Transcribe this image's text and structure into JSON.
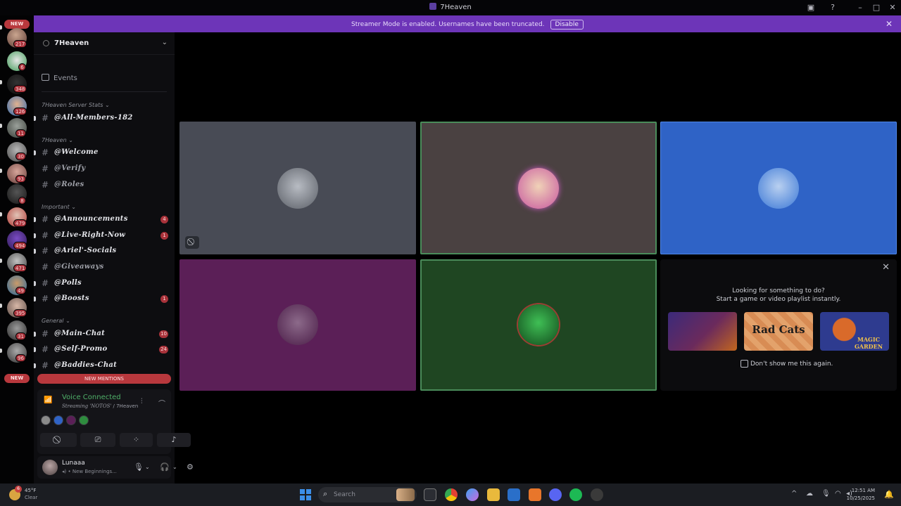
{
  "window": {
    "title": "7Heaven"
  },
  "banner": {
    "message": "Streamer Mode is enabled. Usernames have been truncated.",
    "disable_label": "Disable",
    "background": "#6d35b8"
  },
  "rail": {
    "new_top": "NEW",
    "new_bottom": "NEW",
    "badges": [
      "217",
      "6",
      "348",
      "126",
      "11",
      "30",
      "93",
      "8",
      "479",
      "494",
      "471",
      "49",
      "395",
      "31",
      "96"
    ]
  },
  "server": {
    "name": "7Heaven",
    "events_label": "Events",
    "categories": {
      "stats": "7Heaven Server Stats",
      "main": "7Heaven",
      "important": "Important",
      "general": "General"
    },
    "channels": [
      {
        "name": "𝕬𝖑𝖑-𝕸𝖊𝖒𝖇𝖊𝖗𝖘-182",
        "display": "@All-Members-182",
        "badge": ""
      },
      {
        "name": "welcome",
        "display": "@Welcome",
        "badge": ""
      },
      {
        "name": "verify",
        "display": "@Verify",
        "badge": ""
      },
      {
        "name": "roles",
        "display": "@Roles",
        "badge": ""
      },
      {
        "name": "announcements",
        "display": "@Announcements",
        "badge": "4"
      },
      {
        "name": "live-right-now",
        "display": "@Live-Right-Now",
        "badge": "1"
      },
      {
        "name": "ariel-socials",
        "display": "@Ariel'-Socials",
        "badge": ""
      },
      {
        "name": "giveaways",
        "display": "@Giveaways",
        "badge": ""
      },
      {
        "name": "polls",
        "display": "@Polls",
        "badge": ""
      },
      {
        "name": "boosts",
        "display": "@Boosts",
        "badge": "1"
      },
      {
        "name": "main-chat",
        "display": "@Main-Chat",
        "badge": "10"
      },
      {
        "name": "self-promo",
        "display": "@Self-Promo",
        "badge": "24"
      },
      {
        "name": "baddies-chat",
        "display": "@Baddies-Chat",
        "badge": ""
      }
    ],
    "new_mentions_label": "NEW MENTIONS"
  },
  "voice": {
    "status": "Voice Connected",
    "detail_prefix": "Streaming",
    "detail_channel": "'NOTOS'",
    "detail_suffix": " / 7Heaven"
  },
  "user": {
    "name": "Lunaaa",
    "status": "New Beginnings..."
  },
  "stage": {
    "tile_colors": [
      "#484b55",
      "#4a4141",
      "#2f63c6",
      "#5b1f57",
      "#1f4622"
    ],
    "activity": {
      "line1": "Looking for something to do?",
      "line2": "Start a game or video playlist instantly.",
      "games": [
        "",
        "Rad Cats",
        "MAGIC GARDEN"
      ],
      "dont_show": "Don't show me this again."
    }
  },
  "taskbar": {
    "weather_badge": "6",
    "temperature": "45°F",
    "condition": "Clear",
    "search_placeholder": "Search",
    "time": "12:51 AM",
    "date": "10/25/2025"
  }
}
